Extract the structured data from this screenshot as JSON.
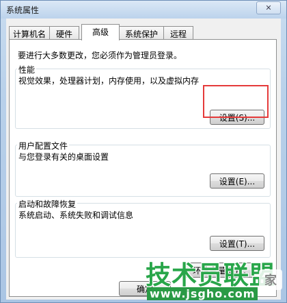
{
  "window": {
    "title": "系统属性",
    "close_glyph": "✕"
  },
  "tabs": [
    {
      "label": "计算机名",
      "active": false
    },
    {
      "label": "硬件",
      "active": false
    },
    {
      "label": "高级",
      "active": true
    },
    {
      "label": "系统保护",
      "active": false
    },
    {
      "label": "远程",
      "active": false
    }
  ],
  "advanced": {
    "notice": "要进行大多数更改，您必须作为管理员登录。",
    "performance": {
      "title": "性能",
      "description": "视觉效果，处理器计划，内存使用，以及虚拟内存",
      "button": "设置(S)..."
    },
    "user_profiles": {
      "title": "用户配置文件",
      "description": "与您登录有关的桌面设置",
      "button": "设置(E)..."
    },
    "startup_recovery": {
      "title": "启动和故障恢复",
      "description": "系统启动、系统失败和调试信息",
      "button": "设置(T)..."
    },
    "env_button": "环境变量(N)..."
  },
  "footer": {
    "ok_partial": "确定"
  },
  "watermark": {
    "main": "技术员联盟",
    "url": "www.jsgho.com",
    "badge": "家"
  },
  "colors": {
    "highlight": "#e53a3a",
    "watermark_green": "#29a64a"
  }
}
